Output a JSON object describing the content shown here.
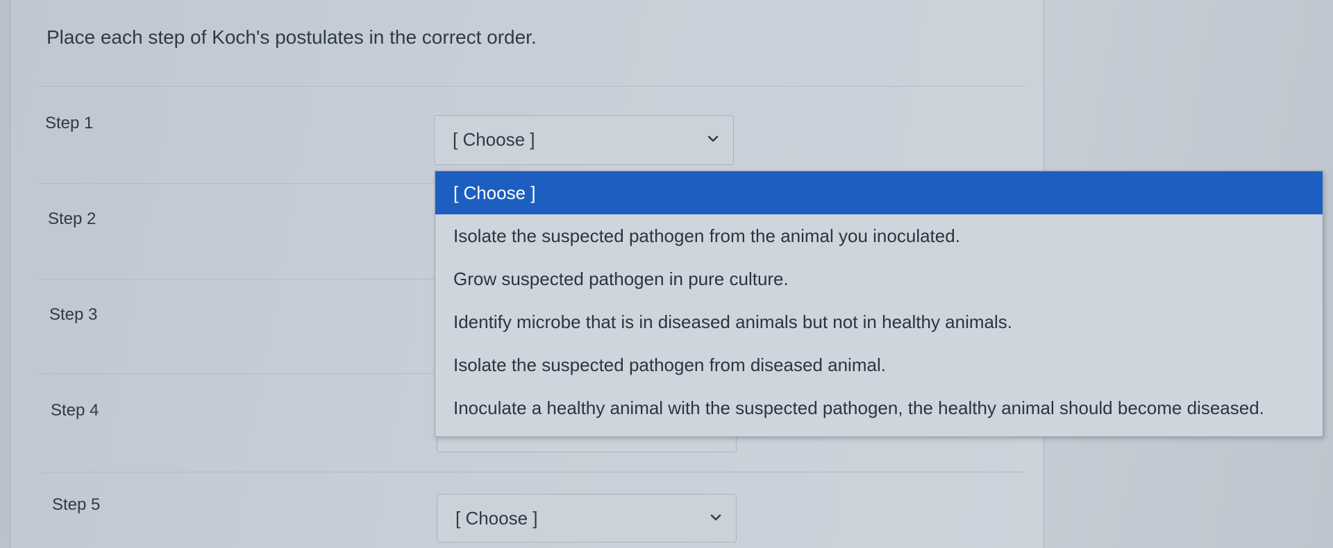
{
  "question": {
    "prompt": "Place each step of Koch's postulates in the correct order."
  },
  "steps": [
    {
      "label": "Step 1",
      "selected": "[ Choose ]"
    },
    {
      "label": "Step 2",
      "selected": ""
    },
    {
      "label": "Step 3",
      "selected": ""
    },
    {
      "label": "Step 4",
      "selected": ""
    },
    {
      "label": "Step 5",
      "selected": "[ Choose ]"
    }
  ],
  "dropdown": {
    "open_for": "Step 1",
    "options": [
      "[ Choose ]",
      "Isolate the suspected pathogen from the animal you inoculated.",
      "Grow suspected pathogen in pure culture.",
      "Identify microbe that is in diseased animals but not in healthy animals.",
      "Isolate the suspected pathogen from diseased animal.",
      "Inoculate a healthy animal with the suspected pathogen, the healthy animal should become diseased."
    ],
    "highlighted_index": 0
  },
  "icons": {
    "select_chevron": "chevron-down-icon"
  },
  "colors": {
    "highlight": "#1d5fc0",
    "text": "#2d3b45"
  }
}
